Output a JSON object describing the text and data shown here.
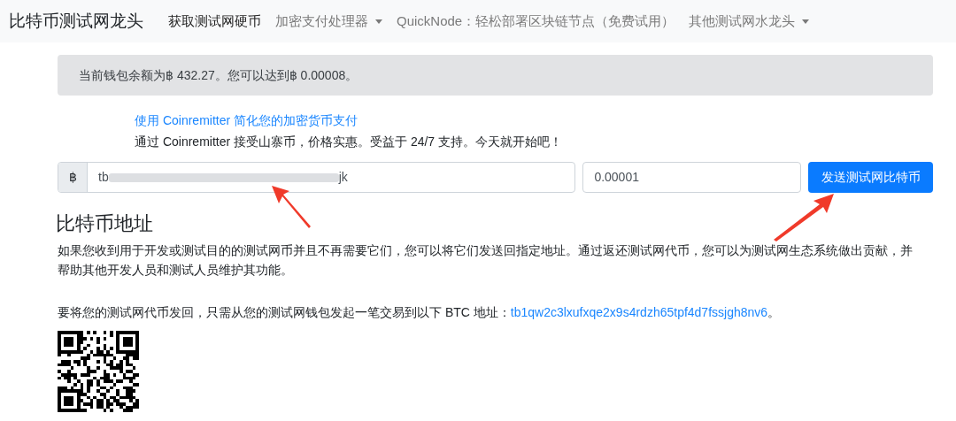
{
  "navbar": {
    "brand": "比特币测试网龙头",
    "items": [
      {
        "label": "获取测试网硬币",
        "selected": true,
        "dropdown": false
      },
      {
        "label": "加密支付处理器",
        "selected": false,
        "dropdown": true
      },
      {
        "label": "QuickNode：轻松部署区块链节点（免费试用）",
        "selected": false,
        "dropdown": false
      },
      {
        "label": "其他测试网水龙头",
        "selected": false,
        "dropdown": true
      }
    ]
  },
  "balance_alert": "当前钱包余额为฿ 432.27。您可以达到฿ 0.00008。",
  "ad": {
    "link": "使用 Coinremitter 简化您的加密货币支付",
    "text": "通过 Coinremitter 接受山寨币，价格实惠。受益于 24/7 支持。今天就开始吧！"
  },
  "form": {
    "prefix": "฿",
    "address_start": "tb",
    "address_end": "jk",
    "amount": "0.00001",
    "button": "发送测试网比特币"
  },
  "section": {
    "heading": "比特币地址",
    "paragraph": "如果您收到用于开发或测试目的的测试网币并且不再需要它们，您可以将它们发送回指定地址。通过返还测试网代币，您可以为测试网生态系统做出贡献，并帮助其他开发人员和测试人员维护其功能。",
    "return_text": "要将您的测试网代币发回，只需从您的测试网钱包发起一笔交易到以下 BTC 地址：",
    "return_address": "tb1qw2c3lxufxqe2x9s4rdzh65tpf4d7fssjgh8nv6",
    "return_end": "。"
  }
}
